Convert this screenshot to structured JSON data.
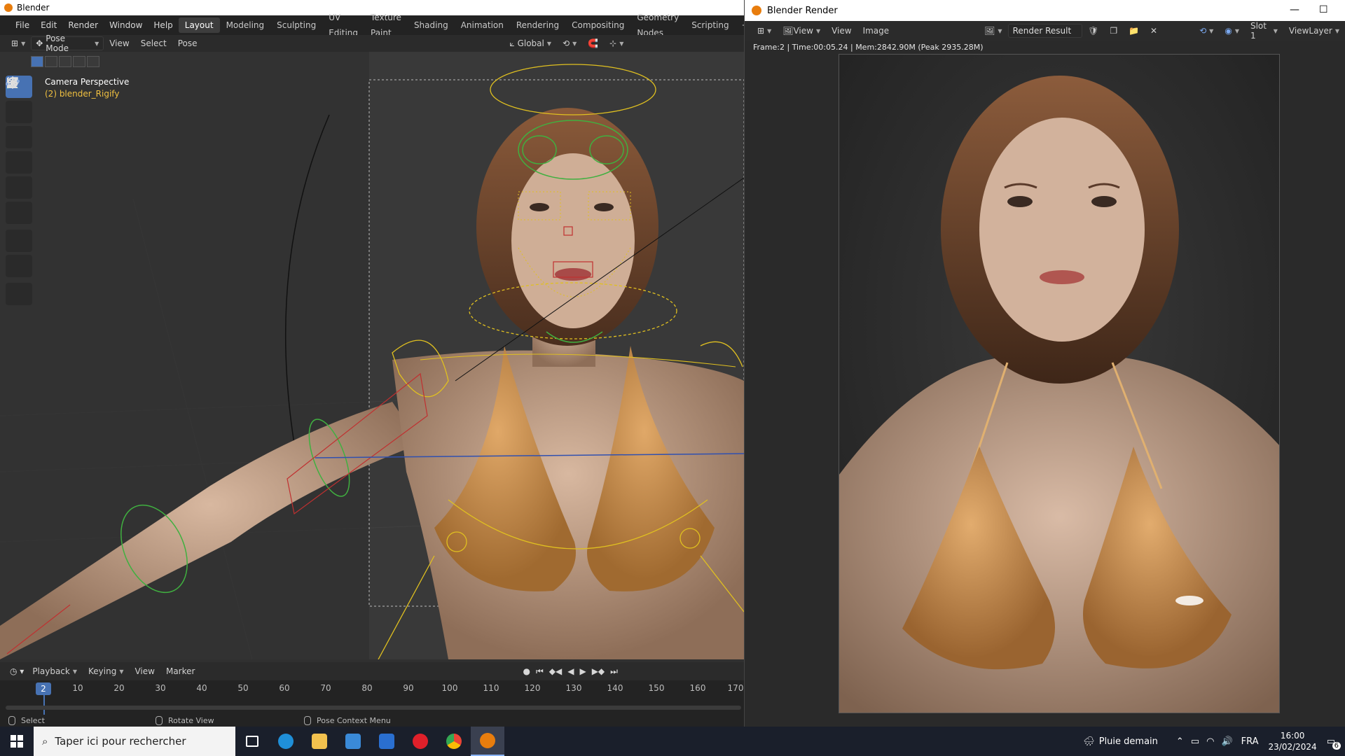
{
  "main_window": {
    "title": "Blender",
    "menu": [
      "File",
      "Edit",
      "Render",
      "Window",
      "Help"
    ],
    "workspaces": [
      "Layout",
      "Modeling",
      "Sculpting",
      "UV Editing",
      "Texture Paint",
      "Shading",
      "Animation",
      "Rendering",
      "Compositing",
      "Geometry Nodes",
      "Scripting"
    ],
    "active_workspace": "Layout",
    "header": {
      "mode": "Pose Mode",
      "items": [
        "View",
        "Select",
        "Pose"
      ],
      "transform_orientation": "Global"
    },
    "viewport": {
      "camera_label": "Camera Perspective",
      "object_label": "(2) blender_Rigify"
    },
    "timeline": {
      "menus": [
        "Playback",
        "Keying",
        "View",
        "Marker"
      ],
      "current_frame": "2",
      "frame_numbers": [
        "10",
        "20",
        "30",
        "40",
        "50",
        "60",
        "70",
        "80",
        "90",
        "100",
        "110",
        "120",
        "130",
        "140",
        "150",
        "160",
        "170"
      ]
    },
    "status_bar": {
      "select": "Select",
      "rotate": "Rotate View",
      "context": "Pose Context Menu"
    }
  },
  "render_window": {
    "title": "Blender Render",
    "header": {
      "view_label": "View",
      "view2": "View",
      "image": "Image",
      "image_name": "Render Result",
      "slot": "Slot 1",
      "view_layer": "ViewLayer"
    },
    "info": "Frame:2 | Time:00:05.24 | Mem:2842.90M (Peak 2935.28M)"
  },
  "taskbar": {
    "search_placeholder": "Taper ici pour rechercher",
    "weather": "Pluie demain",
    "language": "FRA",
    "time": "16:00",
    "date": "23/02/2024",
    "notification_count": "6"
  },
  "colors": {
    "accent": "#4772b3",
    "blender_orange": "#e87d0d",
    "rig_yellow": "#e0c020",
    "rig_green": "#40b040",
    "rig_red": "#c03030"
  }
}
